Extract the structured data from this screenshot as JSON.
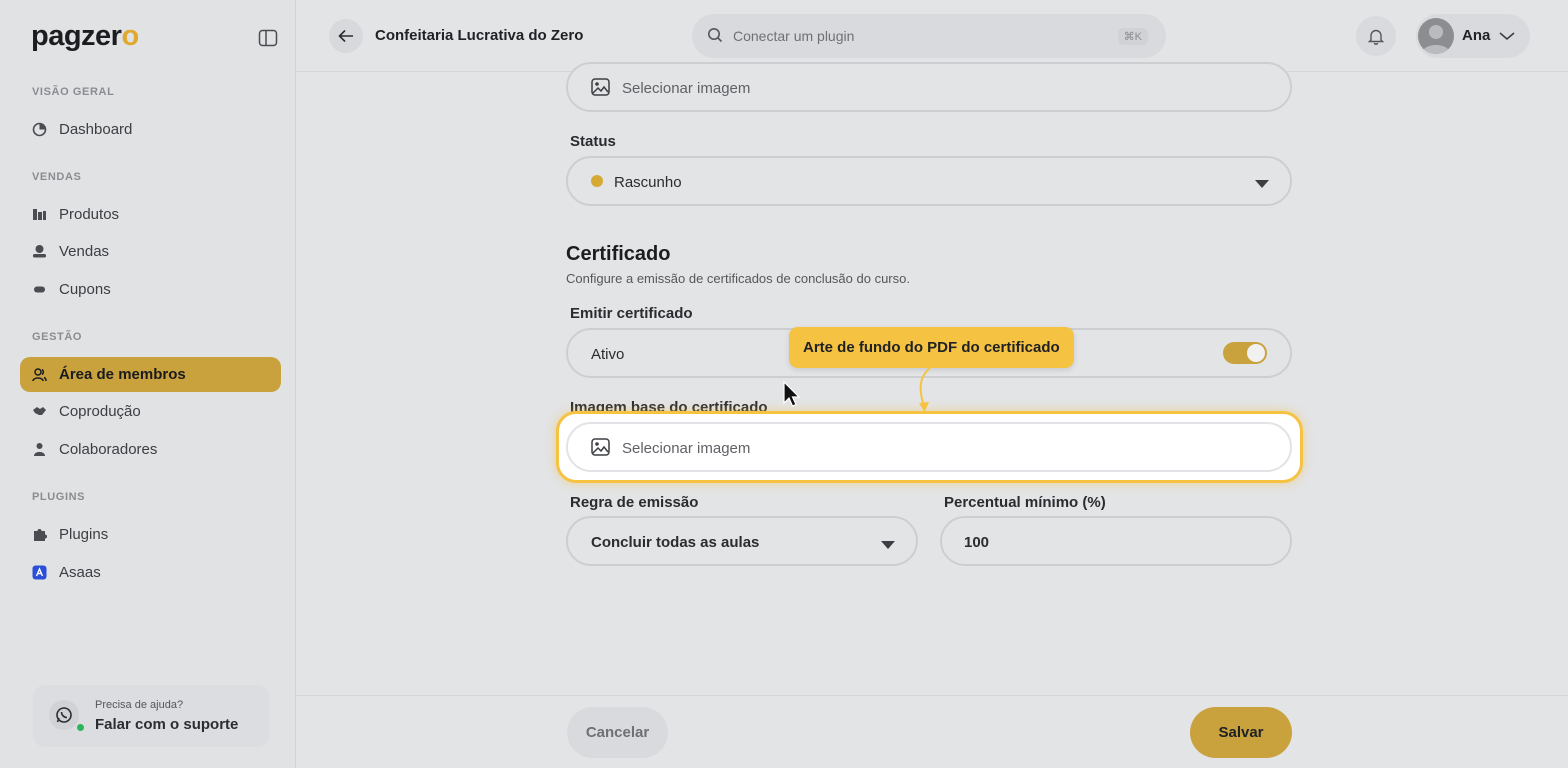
{
  "brand": {
    "logo_main": "pagzer",
    "logo_accent": "o",
    "accent_color": "#c9a23e",
    "highlight_color": "#f5c242"
  },
  "sidebar": {
    "sections": [
      {
        "label": "VISÃO GERAL",
        "items": [
          {
            "label": "Dashboard",
            "icon": "dashboard-icon"
          }
        ]
      },
      {
        "label": "VENDAS",
        "items": [
          {
            "label": "Produtos",
            "icon": "products-icon"
          },
          {
            "label": "Vendas",
            "icon": "sales-icon"
          },
          {
            "label": "Cupons",
            "icon": "coupon-icon"
          }
        ]
      },
      {
        "label": "GESTÃO",
        "items": [
          {
            "label": "Área de membros",
            "icon": "members-icon",
            "active": true
          },
          {
            "label": "Coprodução",
            "icon": "handshake-icon"
          },
          {
            "label": "Colaboradores",
            "icon": "person-icon"
          }
        ]
      },
      {
        "label": "PLUGINS",
        "items": [
          {
            "label": "Plugins",
            "icon": "puzzle-icon"
          },
          {
            "label": "Asaas",
            "icon": "asaas-icon"
          }
        ]
      }
    ],
    "support": {
      "question": "Precisa de ajuda?",
      "link": "Falar com o suporte"
    }
  },
  "topbar": {
    "title": "Confeitaria Lucrativa do Zero",
    "search_placeholder": "Conectar um plugin",
    "search_shortcut": "⌘K",
    "user_name": "Ana"
  },
  "form": {
    "top_image_placeholder": "Selecionar imagem",
    "status_label": "Status",
    "status_value": "Rascunho",
    "status_dot_color": "#d4a934",
    "certificate_title": "Certificado",
    "certificate_subtitle": "Configure a emissão de certificados de conclusão do curso.",
    "emit_label": "Emitir certificado",
    "emit_value": "Ativo",
    "emit_enabled": true,
    "base_image_label": "Imagem base do certificado",
    "base_image_placeholder": "Selecionar imagem",
    "rule_label": "Regra de emissão",
    "rule_value": "Concluir todas as aulas",
    "min_percent_label": "Percentual mínimo (%)",
    "min_percent_value": "100"
  },
  "tooltip": {
    "text": "Arte de fundo do PDF do certificado"
  },
  "footer": {
    "cancel_label": "Cancelar",
    "save_label": "Salvar"
  }
}
